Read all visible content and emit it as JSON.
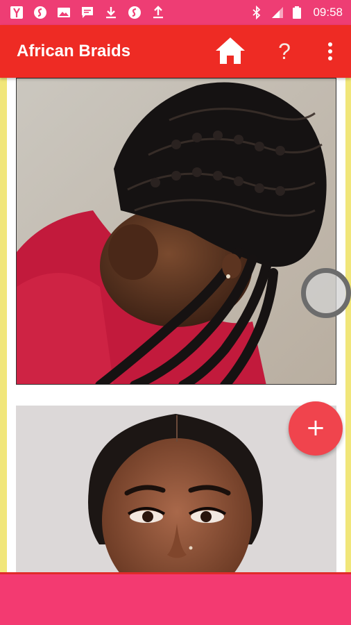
{
  "status_bar": {
    "time": "09:58",
    "icons": [
      "yandex-icon",
      "shazam-icon",
      "image-icon",
      "message-icon",
      "download-icon",
      "shazam-icon",
      "upload-icon",
      "bluetooth-icon",
      "signal-icon",
      "battery-icon"
    ]
  },
  "app_bar": {
    "title": "African Braids",
    "actions": [
      "home-icon",
      "help-icon",
      "more-vert-icon"
    ],
    "help_glyph": "?"
  },
  "fab": {
    "glyph": "+"
  },
  "colors": {
    "status_bar": "#ee3d74",
    "app_bar": "#ee2b24",
    "fab": "#f0444d",
    "bottom_bar": "#f33a71",
    "side_background": "#f1e67a"
  }
}
